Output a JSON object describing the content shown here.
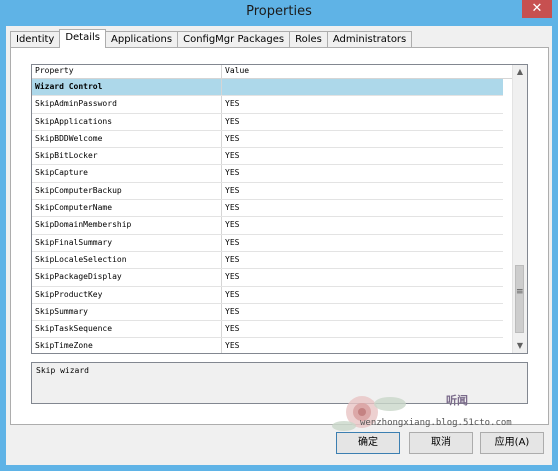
{
  "window": {
    "title": "Properties",
    "close_glyph": "✕"
  },
  "tabs": [
    {
      "label": "Identity"
    },
    {
      "label": "Details"
    },
    {
      "label": "Applications"
    },
    {
      "label": "ConfigMgr Packages"
    },
    {
      "label": "Roles"
    },
    {
      "label": "Administrators"
    }
  ],
  "active_tab": "Details",
  "grid": {
    "columns": {
      "property": "Property",
      "value": "Value"
    },
    "group_row": {
      "property": "Wizard Control",
      "value": ""
    },
    "rows": [
      {
        "property": "SkipAdminPassword",
        "value": "YES"
      },
      {
        "property": "SkipApplications",
        "value": "YES"
      },
      {
        "property": "SkipBDDWelcome",
        "value": "YES"
      },
      {
        "property": "SkipBitLocker",
        "value": "YES"
      },
      {
        "property": "SkipCapture",
        "value": "YES"
      },
      {
        "property": "SkipComputerBackup",
        "value": "YES"
      },
      {
        "property": "SkipComputerName",
        "value": "YES"
      },
      {
        "property": "SkipDomainMembership",
        "value": "YES"
      },
      {
        "property": "SkipFinalSummary",
        "value": "YES"
      },
      {
        "property": "SkipLocaleSelection",
        "value": "YES"
      },
      {
        "property": "SkipPackageDisplay",
        "value": "YES"
      },
      {
        "property": "SkipProductKey",
        "value": "YES"
      },
      {
        "property": "SkipSummary",
        "value": "YES"
      },
      {
        "property": "SkipTaskSequence",
        "value": "YES"
      },
      {
        "property": "SkipTimeZone",
        "value": "YES"
      }
    ],
    "scroll_up_glyph": "▲",
    "scroll_down_glyph": "▼",
    "scroll_grip_glyph": "≡"
  },
  "description": "Skip wizard",
  "watermark": {
    "text1": "听闻",
    "text2": "wenzhongxiang.blog.51cto.com"
  },
  "buttons": {
    "ok": "确定",
    "cancel": "取消",
    "apply": "应用(A)"
  },
  "colors": {
    "title_bar": "#5fb3e6",
    "group_row": "#add8ea",
    "close": "#c75050"
  }
}
